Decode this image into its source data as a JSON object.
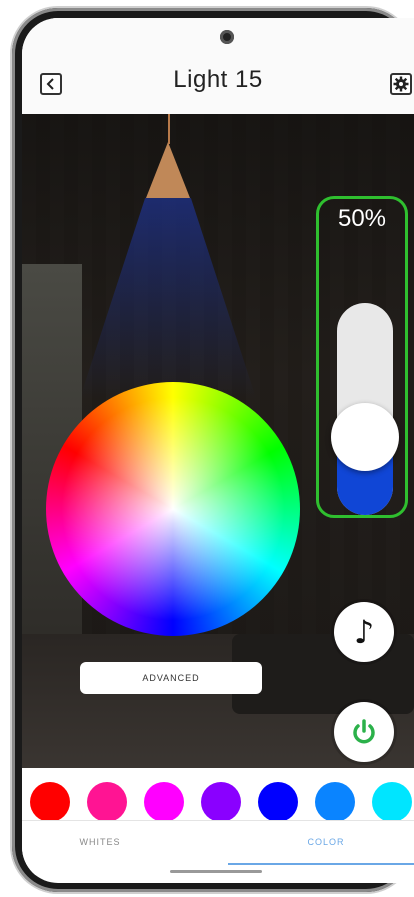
{
  "header": {
    "title": "Light 15",
    "back_icon": "chevron-left-icon",
    "settings_icon": "gear-icon"
  },
  "brightness": {
    "label": "50%",
    "level": 0.5,
    "accent_color": "#1046d6",
    "highlight_color": "#2fbf2f"
  },
  "controls": {
    "advanced_label": "ADVANCED",
    "music_icon": "music-note-icon",
    "power_icon": "power-icon",
    "power_color": "#2bb14a"
  },
  "swatches": [
    {
      "color": "#ff0000"
    },
    {
      "color": "#ff1493"
    },
    {
      "color": "#ff00ff"
    },
    {
      "color": "#8a00ff"
    },
    {
      "color": "#0000ff"
    },
    {
      "color": "#0a84ff"
    },
    {
      "color": "#00e5ff"
    }
  ],
  "tabs": [
    {
      "label": "WHITES",
      "active": false
    },
    {
      "label": "COLOR",
      "active": true
    }
  ]
}
